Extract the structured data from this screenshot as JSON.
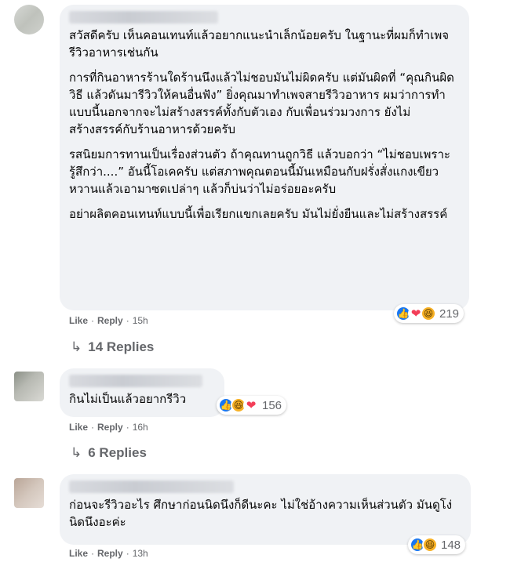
{
  "comments": [
    {
      "paragraphs": [
        "สวัสดีครับ เห็นคอนเทนท์แล้วอยากแนะนำเล็กน้อยครับ ในฐานะที่ผมก็ทำเพจรีวิวอาหารเช่นกัน",
        "การที่กินอาหารร้านใดร้านนึงแล้วไม่ชอบมันไม่ผิดครับ แต่มันผิดที่ “คุณกินผิดวิธี แล้วดันมารีวิวให้คนอื่นฟัง” ยิ่งคุณมาทำเพจสายรีวิวอาหาร ผมว่าการทำแบบนี้นอกจากจะไม่สร้างสรรค์ทั้งกับตัวเอง กับเพื่อนร่วมวงการ ยังไม่สร้างสรรค์กับร้านอาหารด้วยครับ",
        "รสนิยมการทานเป็นเรื่องส่วนตัว ถ้าคุณทานถูกวิธี แล้วบอกว่า “ไม่ชอบเพราะรู้สึกว่า....” อันนี้โอเคครับ แต่สภาพคุณตอนนี้มันเหมือนกับฝรั่งสั่งแกงเขียวหวานแล้วเอามาซดเปล่าๆ แล้วก็บ่นว่าไม่อร่อยอะครับ",
        "อย่าผลิตคอนเทนท์แบบนี้เพื่อเรียกแขกเลยครับ มันไม่ยั่งยืนและไม่สร้างสรรค์"
      ],
      "reaction_count": "219",
      "reactions": [
        "like",
        "love",
        "haha"
      ],
      "like": "Like",
      "reply": "Reply",
      "time": "15h",
      "replies": "14 Replies"
    },
    {
      "paragraphs": [
        "กินไม่เป็นแล้วอยากรีวิว"
      ],
      "reaction_count": "156",
      "reactions": [
        "like",
        "haha",
        "love"
      ],
      "like": "Like",
      "reply": "Reply",
      "time": "16h",
      "replies": "6 Replies"
    },
    {
      "paragraphs": [
        "ก่อนจะรีวิวอะไร ศึกษาก่อนนิดนึงก็ดีนะคะ ไม่ใช่อ้างความเห็นส่วนตัว มันดูโง่นิดนึงอะค่ะ"
      ],
      "reaction_count": "148",
      "reactions": [
        "like",
        "haha"
      ],
      "like": "Like",
      "reply": "Reply",
      "time": "13h"
    }
  ],
  "colors": {
    "bubble": "#f0f2f5",
    "meta": "#65676b",
    "like_blue": "#1877f2",
    "love_red": "#f33e58",
    "haha_yellow": "#f7b125"
  }
}
